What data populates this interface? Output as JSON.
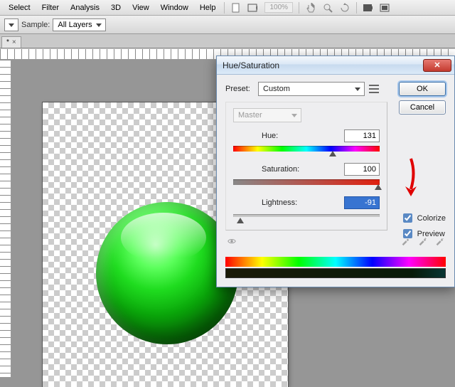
{
  "menubar": {
    "items": [
      "Select",
      "Filter",
      "Analysis",
      "3D",
      "View",
      "Window",
      "Help"
    ],
    "zoom": "100%"
  },
  "optionsbar": {
    "sample_label": "Sample:",
    "sample_value": "All Layers"
  },
  "doctab": {
    "label": "* ×",
    "name": "*"
  },
  "dialog": {
    "title": "Hue/Saturation",
    "preset_label": "Preset:",
    "preset_value": "Custom",
    "ok": "OK",
    "cancel": "Cancel",
    "channel": "Master",
    "hue_label": "Hue:",
    "hue_value": "131",
    "sat_label": "Saturation:",
    "sat_value": "100",
    "light_label": "Lightness:",
    "light_value": "-91",
    "colorize_label": "Colorize",
    "preview_label": "Preview",
    "colorize_checked": true,
    "preview_checked": true
  }
}
